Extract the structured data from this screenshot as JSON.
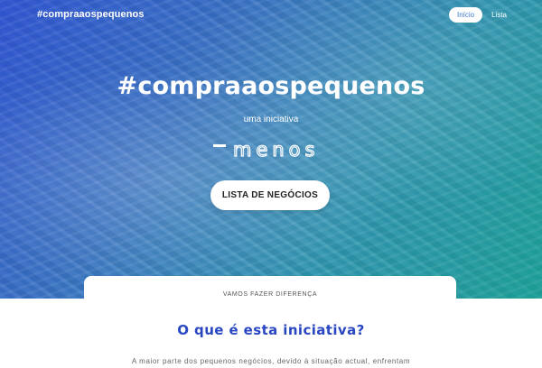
{
  "header": {
    "brand": "#compraaospequenos",
    "nav": [
      {
        "label": "Início",
        "active": true
      },
      {
        "label": "Lista",
        "active": false
      }
    ]
  },
  "hero": {
    "title": "#compraaospequenos",
    "subtitle": "uma iniciativa",
    "logo_text": "menos",
    "cta_label": "LISTA DE NEGÓCIOS"
  },
  "card": {
    "label": "VAMOS FAZER DIFERENÇA"
  },
  "section": {
    "title": "O que é esta iniciativa?",
    "text": "A maior parte dos pequenos negócios, devido à situação actual, enfrentam"
  },
  "colors": {
    "accent": "#2a47c2",
    "gradient_start": "#2d50d2",
    "gradient_end": "#19a096"
  }
}
